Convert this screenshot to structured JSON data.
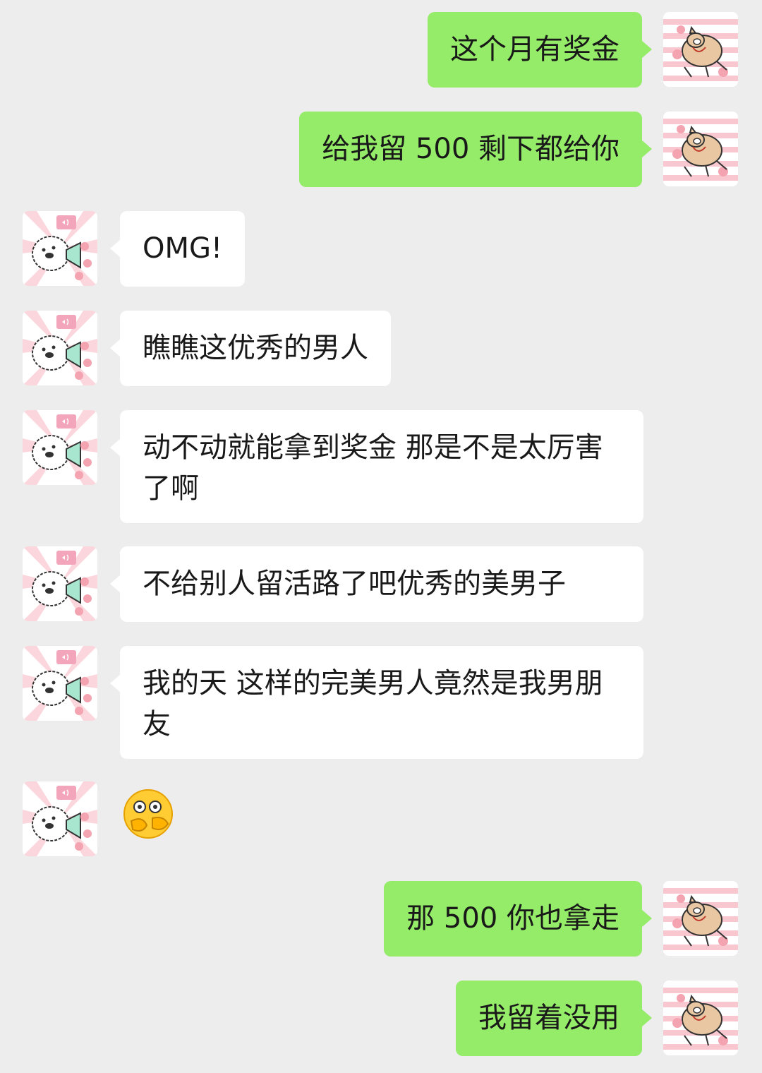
{
  "colors": {
    "background": "#ededed",
    "self_bubble": "#95ec69",
    "friend_bubble": "#ffffff",
    "text": "#191919"
  },
  "avatars": {
    "self": "pig-cartoon-avatar",
    "friend": "white-puppy-megaphone-avatar"
  },
  "messages": [
    {
      "sender": "self",
      "text": "这个月有奖金"
    },
    {
      "sender": "self",
      "text": "给我留 500 剩下都给你"
    },
    {
      "sender": "friend",
      "text": "OMG!"
    },
    {
      "sender": "friend",
      "text": "瞧瞧这优秀的男人"
    },
    {
      "sender": "friend",
      "text": "动不动就能拿到奖金 那是不是太厉害了啊"
    },
    {
      "sender": "friend",
      "text": "不给别人留活路了吧优秀的美男子"
    },
    {
      "sender": "friend",
      "text": "我的天 这样的完美男人竟然是我男朋友"
    },
    {
      "sender": "friend",
      "sticker": "shy-face-emoji"
    },
    {
      "sender": "self",
      "text": "那 500 你也拿走"
    },
    {
      "sender": "self",
      "text": "我留着没用"
    }
  ]
}
